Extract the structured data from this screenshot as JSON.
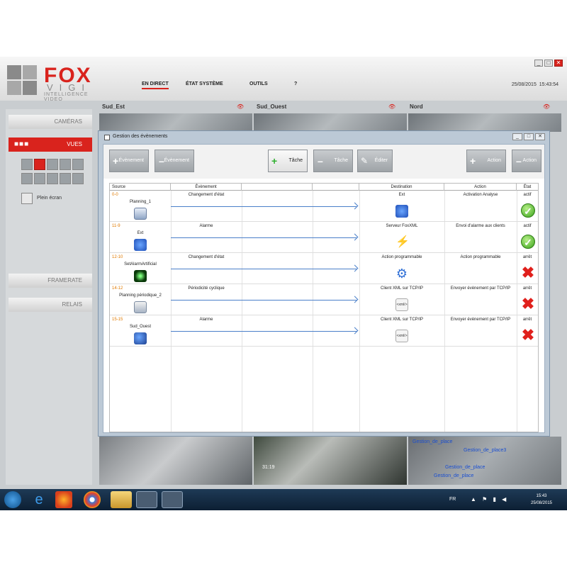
{
  "app": {
    "logo": {
      "fox": "FOX",
      "vigi": "VIGI",
      "tagline": "INTELLIGENCE VIDEO"
    },
    "menu": [
      "EN DIRECT",
      "ÉTAT SYSTÈME",
      "OUTILS",
      "?"
    ],
    "date": "25/08/2015",
    "time": "15:43:54",
    "window_controls": [
      "_",
      "□",
      "✕"
    ]
  },
  "sidebar": {
    "cameras": "CAMÉRAS",
    "views": "VUES",
    "fullscreen": "Plein écran",
    "framerate": "FRAMERATE",
    "relays": "RELAIS"
  },
  "cameras": [
    "Sud_Est",
    "Sud_Ouest",
    "Nord"
  ],
  "bottom_camera_overlay": {
    "label1": "Gestion_de_place",
    "label2": "Gestion_de_place3",
    "label3": "Gestion_de_place",
    "label4": "Gestion_de_place",
    "timestamp": "31:19"
  },
  "dialog": {
    "title": "Gestion des évènements",
    "toolbar": {
      "add_event": "Évènement",
      "remove_event": "Évènement",
      "add_task": "Tâche",
      "remove_task": "Tâche",
      "edit": "Éditer",
      "add_action": "Action",
      "remove_action": "Action"
    },
    "columns": {
      "source": "Source",
      "event": "Évènement",
      "destination": "Destination",
      "action": "Action",
      "state": "État"
    },
    "rows": [
      {
        "id": "0-0",
        "source": "Planning_1",
        "event": "Changement d'état",
        "destination": "Ext",
        "action": "Activation Analyse",
        "state": "actif",
        "ok": true
      },
      {
        "id": "11-9",
        "source": "Ext",
        "event": "Alarme",
        "destination": "Serveur FoxXML",
        "action": "Envoi d'alarme aux clients",
        "state": "actif",
        "ok": true
      },
      {
        "id": "12-10",
        "source": "SetAlarmArtificial",
        "event": "Changement d'état",
        "destination": "Action programmable",
        "action": "Action programmable",
        "state": "arrêt",
        "ok": false
      },
      {
        "id": "14-12",
        "source": "Planning périodique_2",
        "event": "Périodicité cyclique",
        "destination": "Client XML sur TCP/IP",
        "action": "Envoyer évènement par TCP/IP",
        "state": "arrêt",
        "ok": false
      },
      {
        "id": "15-15",
        "source": "Sud_Ouest",
        "event": "Alarme",
        "destination": "Client XML sur TCP/IP",
        "action": "Envoyer évènement par TCP/IP",
        "state": "arrêt",
        "ok": false
      }
    ]
  },
  "taskbar": {
    "lang": "FR",
    "clock_time": "15:43",
    "clock_date": "25/08/2015"
  },
  "colors": {
    "brand_red": "#d9231d",
    "arrow_blue": "#4a7fc9",
    "id_orange": "#e07a00"
  }
}
